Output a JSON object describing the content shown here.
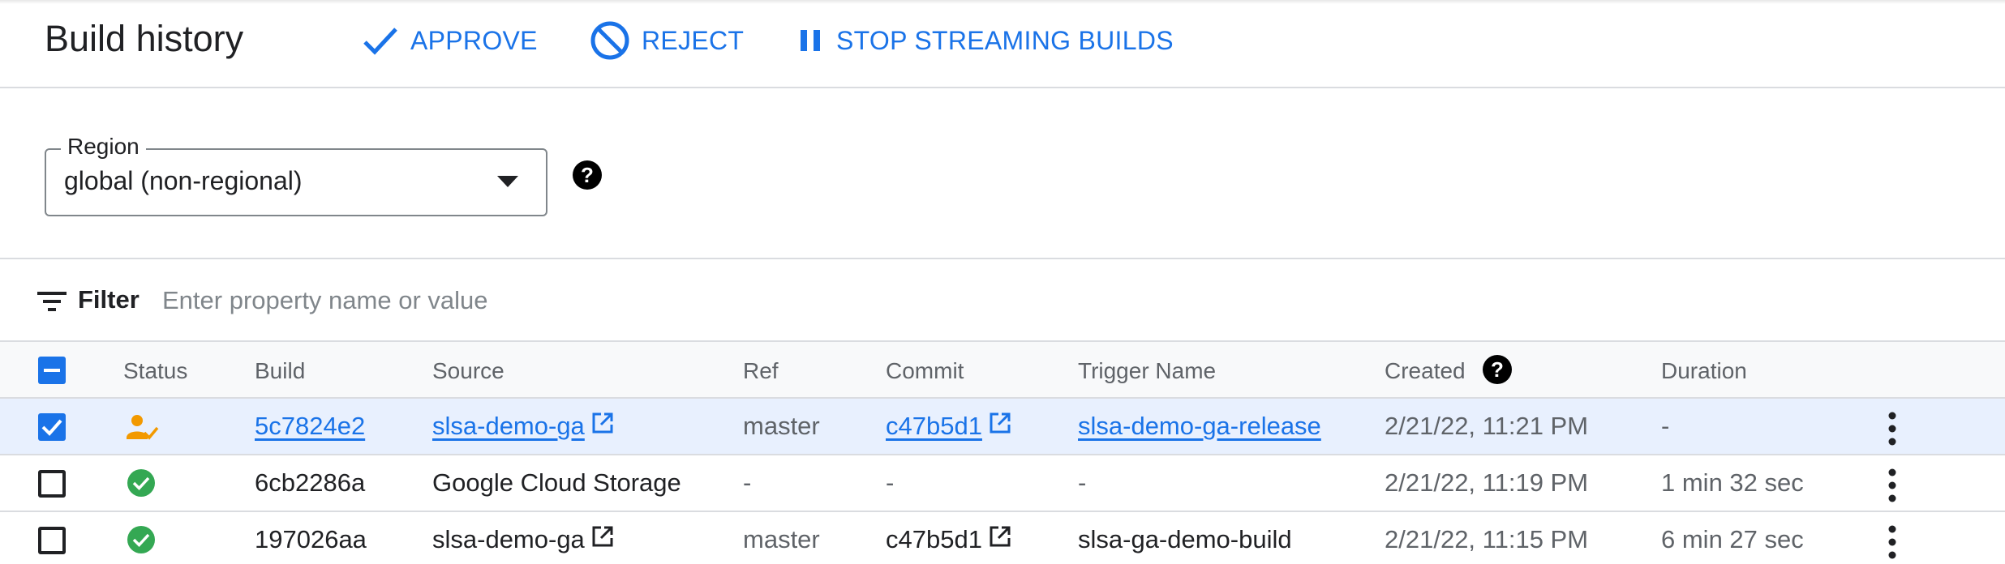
{
  "header": {
    "title": "Build history",
    "approve_label": "APPROVE",
    "reject_label": "REJECT",
    "stop_label": "STOP STREAMING BUILDS"
  },
  "region": {
    "legend": "Region",
    "value": "global (non-regional)"
  },
  "filter": {
    "label": "Filter",
    "placeholder": "Enter property name or value"
  },
  "table": {
    "columns": {
      "status": "Status",
      "build": "Build",
      "source": "Source",
      "ref": "Ref",
      "commit": "Commit",
      "trigger": "Trigger Name",
      "created": "Created",
      "duration": "Duration"
    },
    "rows": [
      {
        "selected": true,
        "status": "awaiting-approval",
        "build": "5c7824e2",
        "source": "slsa-demo-ga",
        "ref": "master",
        "commit": "c47b5d1",
        "trigger": "slsa-demo-ga-release",
        "created": "2/21/22, 11:21 PM",
        "duration": "-"
      },
      {
        "selected": false,
        "status": "success",
        "build": "6cb2286a",
        "source": "Google Cloud Storage",
        "ref": "-",
        "commit": "-",
        "trigger": "-",
        "created": "2/21/22, 11:19 PM",
        "duration": "1 min 32 sec"
      },
      {
        "selected": false,
        "status": "success",
        "build": "197026aa",
        "source": "slsa-demo-ga",
        "ref": "master",
        "commit": "c47b5d1",
        "trigger": "slsa-ga-demo-build",
        "created": "2/21/22, 11:15 PM",
        "duration": "6 min 27 sec"
      }
    ]
  },
  "colors": {
    "accent": "#1a73e8",
    "success": "#34a853",
    "pending": "#f29900",
    "selected_row": "#e8f0fe"
  }
}
